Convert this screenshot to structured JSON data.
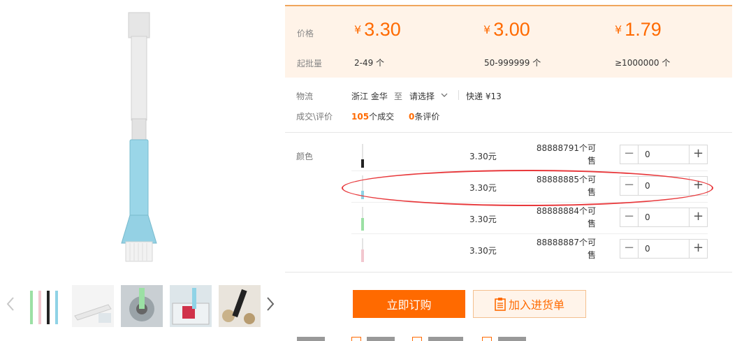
{
  "price_box": {
    "price_label": "价格",
    "min_qty_label": "起批量",
    "tiers": [
      {
        "currency": "¥",
        "price": "3.30",
        "range": "2-49 个"
      },
      {
        "currency": "¥",
        "price": "3.00",
        "range": "50-999999 个"
      },
      {
        "currency": "¥",
        "price": "1.79",
        "range": "≥1000000 个"
      }
    ]
  },
  "logistics": {
    "label": "物流",
    "origin": "浙江 金华",
    "to": "至",
    "destination": "请选择",
    "shipping": "快递 ¥13"
  },
  "deals": {
    "label": "成交\\评价",
    "deal_count": "105",
    "deal_suffix": "个成交",
    "review_count": "0",
    "review_suffix": "条评价"
  },
  "sku": {
    "label": "颜色",
    "rows": [
      {
        "price": "3.30元",
        "stock": "88888791个可售",
        "qty": "0"
      },
      {
        "price": "3.30元",
        "stock": "88888885个可售",
        "qty": "0"
      },
      {
        "price": "3.30元",
        "stock": "88888884个可售",
        "qty": "0"
      },
      {
        "price": "3.30元",
        "stock": "88888887个可售",
        "qty": "0"
      }
    ],
    "minus": "−",
    "plus": "+"
  },
  "actions": {
    "buy_label": "立即订购",
    "cart_label": "加入进货单"
  },
  "colors": {
    "accent": "#ff6a00",
    "price_bg": "#fff3e8",
    "annotation": "#e8393c",
    "brush_handle": "#e4e4e4",
    "brush_blue": "#8fd3e6",
    "brush_green": "#9be0a4",
    "brush_pink": "#f2c7cf",
    "brush_black": "#222222"
  }
}
